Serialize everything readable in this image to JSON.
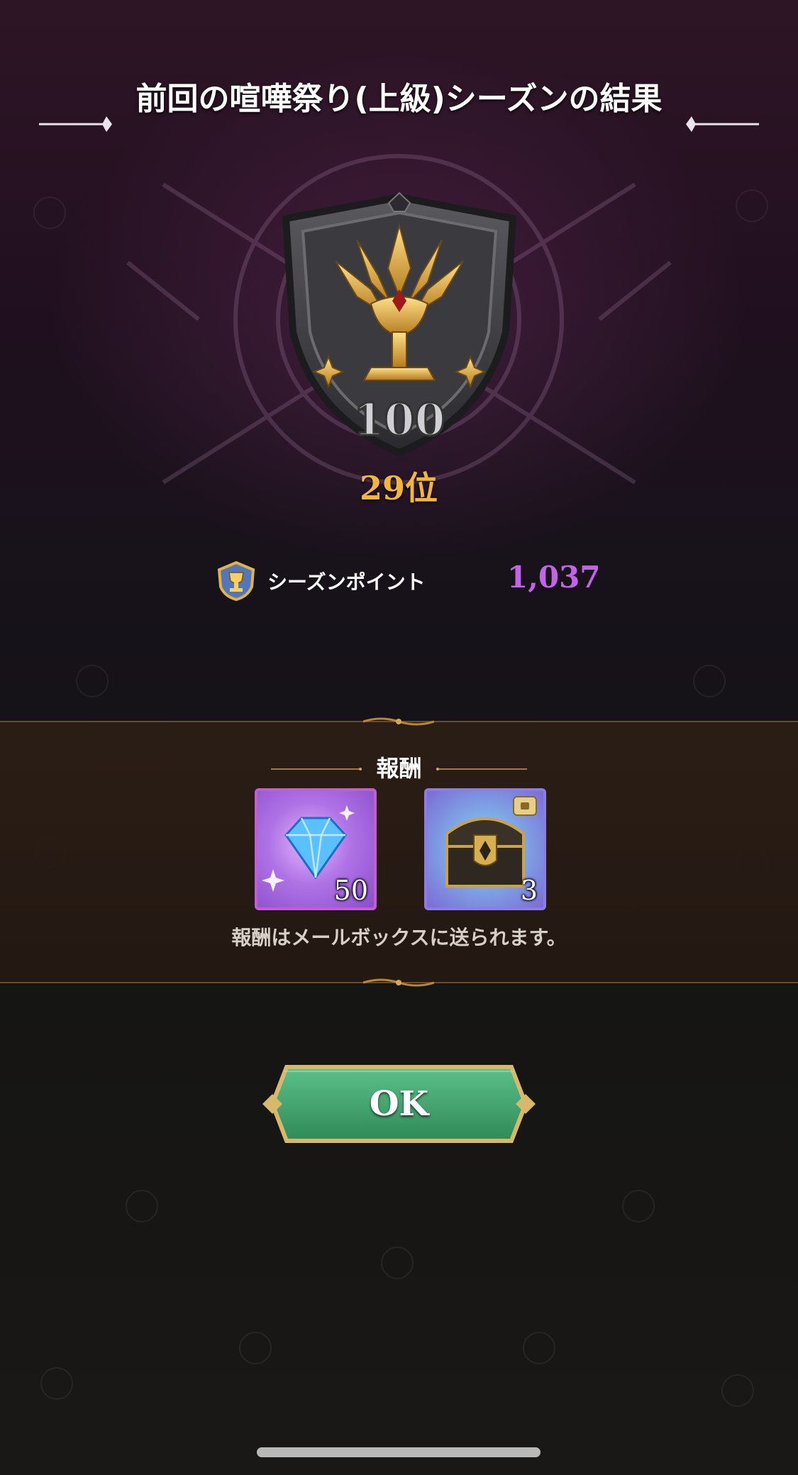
{
  "dialog": {
    "title": "前回の喧嘩祭り(上級)シーズンの結果"
  },
  "rank": {
    "badge_icon": "trophy-shield-badge",
    "badge_number": "100",
    "position_text": "29位"
  },
  "season_points": {
    "icon": "trophy-medal-icon",
    "label": "シーズンポイント",
    "value": "1,037",
    "value_color": "#c364e8"
  },
  "rewards": {
    "header": "報酬",
    "items": [
      {
        "icon": "blue-gem-icon",
        "quantity": "50"
      },
      {
        "icon": "treasure-chest-icon",
        "quantity": "3"
      }
    ],
    "note": "報酬はメールボックスに送られます。"
  },
  "ok_button": {
    "label": "OK",
    "color": "#3f9e6a"
  },
  "colors": {
    "rank_gold": "#f3b63a",
    "band_border": "#6b4a28"
  }
}
